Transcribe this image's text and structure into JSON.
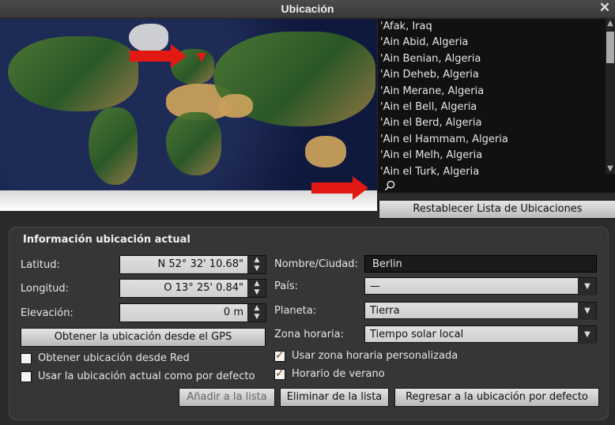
{
  "window": {
    "title": "Ubicación",
    "close_glyph": "✕"
  },
  "location_list": {
    "items": [
      "'Afak, Iraq",
      "'Ain Abid, Algeria",
      "'Ain Benian, Algeria",
      "'Ain Deheb, Algeria",
      "'Ain Merane, Algeria",
      "'Ain el Bell, Algeria",
      "'Ain el Berd, Algeria",
      "'Ain el Hammam, Algeria",
      "'Ain el Melh, Algeria",
      "'Ain el Turk, Algeria"
    ]
  },
  "reset_button": {
    "label": "Restablecer Lista de Ubicaciones"
  },
  "panel": {
    "title": "Información ubicación actual",
    "latitude": {
      "label": "Latitud:",
      "value": "N 52° 32' 10.68\""
    },
    "longitude": {
      "label": "Longitud:",
      "value": "O 13° 25' 0.84\""
    },
    "elevation": {
      "label": "Elevación:",
      "value": "0 m"
    },
    "gps_button": "Obtener la ubicación desde el GPS",
    "net_checkbox": "Obtener ubicación desde Red",
    "default_checkbox": "Usar la ubicación actual como por defecto",
    "name": {
      "label": "Nombre/Ciudad:",
      "value": "Berlin"
    },
    "country": {
      "label": "País:",
      "value": "—"
    },
    "planet": {
      "label": "Planeta:",
      "value": "Tierra"
    },
    "timezone": {
      "label": "Zona horaria:",
      "value": "Tiempo solar local"
    },
    "custom_tz_checkbox": "Usar zona horaria personalizada",
    "dst_checkbox": "Horario de verano",
    "add_button": "Añadir a la lista",
    "delete_button": "Eliminar de la lista",
    "return_button": "Regresar a la ubicación por defecto"
  }
}
